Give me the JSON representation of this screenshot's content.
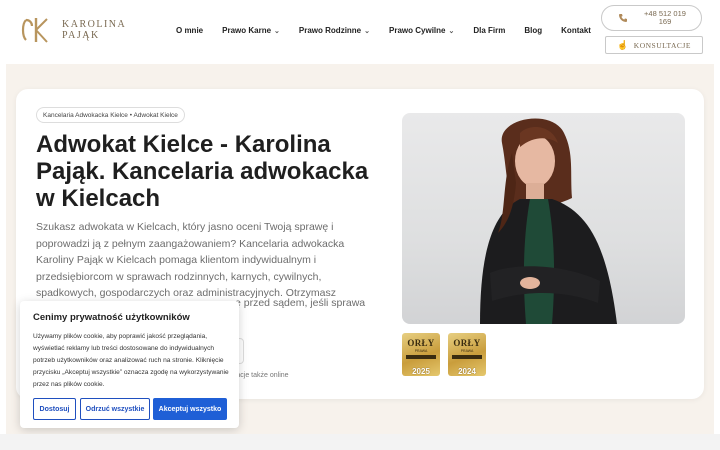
{
  "header": {
    "logo_name_line1": "KAROLINA",
    "logo_name_line2": "PAJĄK",
    "nav": [
      {
        "label": "O mnie",
        "has_dropdown": false
      },
      {
        "label": "Prawo Karne",
        "has_dropdown": true
      },
      {
        "label": "Prawo Rodzinne",
        "has_dropdown": true
      },
      {
        "label": "Prawo Cywilne",
        "has_dropdown": true
      },
      {
        "label": "Dla Firm",
        "has_dropdown": false
      },
      {
        "label": "Blog",
        "has_dropdown": false
      },
      {
        "label": "Kontakt",
        "has_dropdown": false
      }
    ],
    "phone": "+48 512 019 169",
    "consult_label": "KONSULTACJE"
  },
  "hero": {
    "breadcrumb": "Kancelaria Adwokacka Kielce • Adwokat Kielce",
    "title": "Adwokat Kielce - Karolina Pająk. Kancelaria adwokacka w Kielcach",
    "description": "Szukasz adwokata w Kielcach, który jasno oceni Twoją sprawę i poprowadzi ją z pełnym zaangażowaniem? Kancelaria adwokacka Karoliny Pająk w Kielcach pomaga klientom indywidualnym i przedsiębiorcom w sprawach rodzinnych, karnych, cywilnych, spadkowych, gospodarczych oraz administracyjnych. Otrzymasz konkretną poradę prawną, spokojne",
    "description_tail": "ę przed sądem, jeśli sprawa",
    "online_note": "ultacje także online"
  },
  "badges": [
    {
      "title": "ORŁY",
      "sub": "PRAWA",
      "year": "2025"
    },
    {
      "title": "ORŁY",
      "sub": "PRAWA",
      "year": "2024"
    }
  ],
  "cookie": {
    "title": "Cenimy prywatność użytkowników",
    "text": "Używamy plików cookie, aby poprawić jakość przeglądania, wyświetlać reklamy lub treści dostosowane do indywidualnych potrzeb użytkowników oraz analizować ruch na stronie. Kliknięcie przycisku „Akceptuj wszystkie” oznacza zgodę na wykorzystywanie przez nas plików cookie.",
    "btn_customize": "Dostosuj",
    "btn_reject": "Odrzuć wszystkie",
    "btn_accept": "Akceptuj wszystko"
  },
  "colors": {
    "brand_gold": "#7a6a52",
    "accent_blue": "#1f5fd6",
    "band_bg": "#f7f2ec"
  }
}
